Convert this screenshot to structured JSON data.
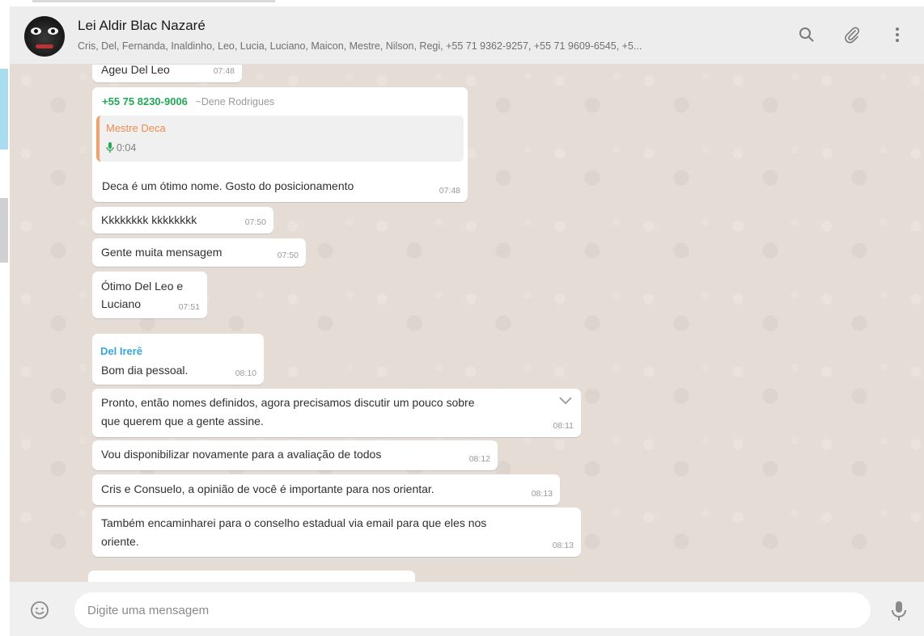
{
  "header": {
    "title": "Lei Aldir Blac Nazaré",
    "subtitle": "Cris, Del, Fernanda, Inaldinho, Leo, Lucia, Luciano, Maicon, Mestre, Nilson, Regi, +55 71 9362-9257, +55 71 9609-6545, +5...",
    "icons": [
      "search-icon",
      "attach-icon",
      "menu-icon"
    ]
  },
  "messages": [
    {
      "text": "Ageu Del Leo",
      "time": "07:48"
    },
    {
      "sender": "+55 75 8230-9006",
      "sender_name": "~Dene Rodrigues",
      "quote_name": "Mestre Deca",
      "quote_audio": "0:04",
      "text": "Deca é um ótimo nome. Gosto do posicionamento",
      "time": "07:48"
    },
    {
      "text": "Kkkkkkkk kkkkkkkk",
      "time": "07:50"
    },
    {
      "text": "Gente muita mensagem",
      "time": "07:50"
    },
    {
      "text_line1": "Ótimo Del Leo e",
      "text_line2": "Luciano",
      "time": "07:51"
    },
    {
      "sender": "Del Irerê",
      "text": "Bom dia pessoal.",
      "time": "08:10"
    },
    {
      "text_line1": "Pronto, então nomes definidos, agora precisamos discutir um pouco sobre",
      "text_line2": "que querem que a gente assine.",
      "time": "08:11"
    },
    {
      "text": "Vou disponibilizar novamente para a avaliação de todos",
      "time": "08:12"
    },
    {
      "text": "Cris e Consuelo, a opinião de você é importante para nos orientar.",
      "time": "08:13"
    },
    {
      "text_line1": "Também encaminharei para o conselho estadual via email para que eles nos",
      "text_line2": "oriente.",
      "time": "08:13"
    }
  ],
  "composer": {
    "placeholder": "Digite uma mensagem"
  },
  "colors": {
    "chat_bg": "#e5ddd5",
    "header_bg": "#ededed",
    "phone_sender": "#1fa855",
    "name_sender": "#35a7d9",
    "quote_name": "#f08a4b",
    "audio_icon": "#2aa55a"
  }
}
